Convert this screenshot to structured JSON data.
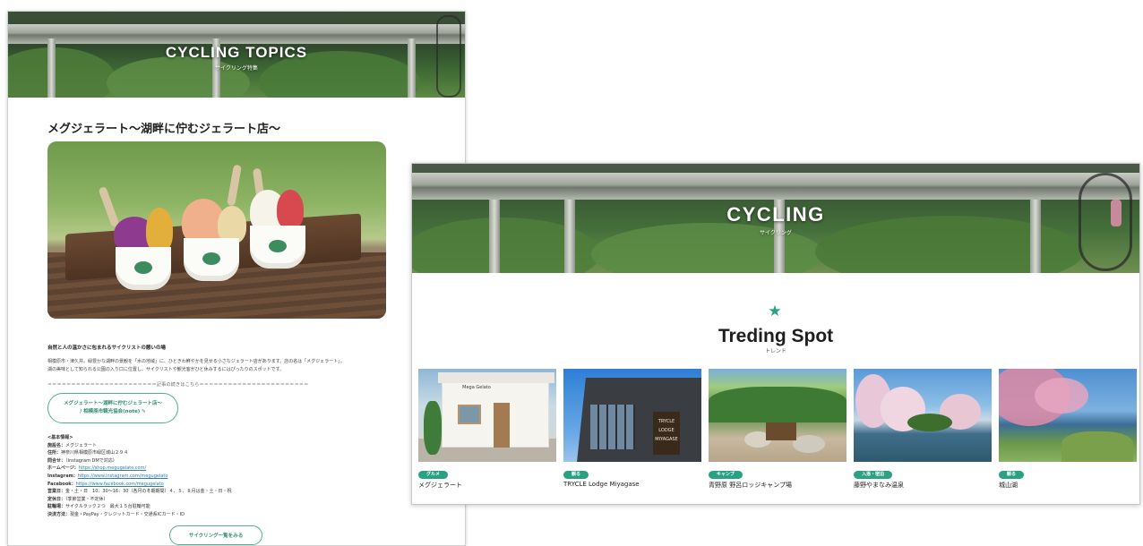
{
  "left_page": {
    "hero": {
      "title": "CYCLING TOPICS",
      "subtitle": "サイクリング特集"
    },
    "article_title": "メグジェラート〜湖畔に佇むジェラート店〜",
    "photo_cup_brand": "Mega Gelato",
    "section_heading": "自然と人の温かさに包まれるサイクリストの憩いの場",
    "paragraph": [
      "相模原市・津久井。緑豊かな湖畔の景観を「水の地域」に、ひときわ鮮やかを見せる小さなジェラート店があります。店の名は「メグジェラート」。",
      "湖の美味として知られる公園の入り口に位置し、サイクリストや観光客がひと休みするにはぴったりのスポットです。"
    ],
    "separator": "＝＝＝＝＝＝＝＝＝＝＝＝＝＝＝＝＝＝＝＝＝＝＝記事の続きはこちら＝＝＝＝＝＝＝＝＝＝＝＝＝＝＝＝＝＝＝＝＝＝＝",
    "note_button": {
      "line1": "メグジェラート〜湖畔に佇むジェラート店〜",
      "line2": "/ 相模原市観光協会(note)"
    },
    "info_heading": "<基本情報>",
    "info_rows": [
      {
        "label": "施設名：",
        "value": "メグジェラート"
      },
      {
        "label": "住所：",
        "value": "神奈川県相模原市緑区城山２９４"
      },
      {
        "label": "問合せ：",
        "value": "（Instagram DMで対応）"
      },
      {
        "label": "ホームページ：",
        "link": "https://shop.megugelato.com/"
      },
      {
        "label": "Instagram：",
        "link": "https://www.instagram.com/megugelato"
      },
      {
        "label": "Facebook：",
        "link": "https://www.facebook.com/megugelato"
      },
      {
        "label": "営業日：",
        "value": "金・土・日　10：30〜16：30（各月の冬期期間）４、５、８月は金・土・日・祝"
      },
      {
        "label": "定休日：",
        "value": "（季節営業・不定休）"
      },
      {
        "label": "駐輪場：",
        "value": "サイクルラック２つ　最大１５台駐輪可能"
      },
      {
        "label": "決済方法：",
        "value": "現金・PayPay・クレジットカード・交通系ICカード・ID"
      }
    ],
    "more_button": "サイクリング一覧をみる"
  },
  "right_page": {
    "hero": {
      "title": "CYCLING",
      "subtitle": "サイクリング"
    },
    "section_icon": "star-icon",
    "section_title": "Treding Spot",
    "section_subtitle": "トレンド",
    "cards": [
      {
        "tag": "グルメ",
        "name": "メグジェラート",
        "photo_sign": "Mega Gelato"
      },
      {
        "tag": "観る",
        "name": "TRYCLE Lodge Miyagase",
        "photo_sign": "TRYCLE LODGE MIYAGASE"
      },
      {
        "tag": "キャンプ",
        "name": "青野原 野呂ロッジキャンプ場",
        "photo_sign": ""
      },
      {
        "tag": "入浴・宿泊",
        "name": "藤野やまなみ温泉",
        "photo_sign": ""
      },
      {
        "tag": "観る",
        "name": "城山湖",
        "photo_sign": ""
      }
    ],
    "accent_color": "#2aa182"
  }
}
